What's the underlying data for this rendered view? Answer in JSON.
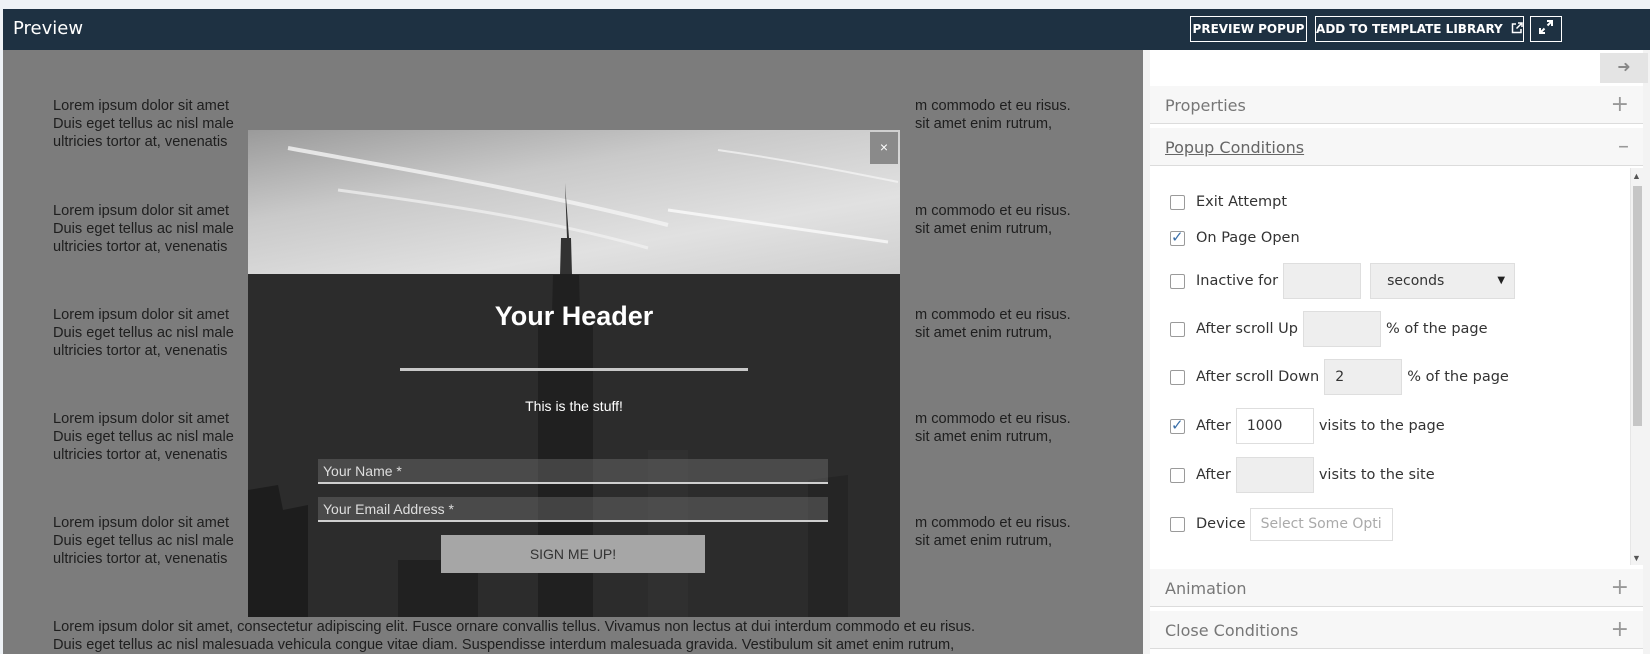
{
  "topbar": {
    "title": "Preview",
    "preview_popup_label": "PREVIEW POPUP",
    "add_template_label": "ADD TO TEMPLATE LIBRARY",
    "external_icon": "external-link-icon",
    "expand_icon": "expand-icon"
  },
  "preview": {
    "paragraphs": [
      {
        "l1": "Lorem ipsum dolor sit amet",
        "l2": "Duis eget tellus ac nisl male",
        "l3": "ultricies tortor at, venenatis",
        "r1": "m commodo et eu risus.",
        "r2": "sit amet enim rutrum,"
      },
      {
        "l1": "Lorem ipsum dolor sit amet",
        "l2": "Duis eget tellus ac nisl male",
        "l3": "ultricies tortor at, venenatis",
        "r1": "m commodo et eu risus.",
        "r2": "sit amet enim rutrum,"
      },
      {
        "l1": "Lorem ipsum dolor sit amet",
        "l2": "Duis eget tellus ac nisl male",
        "l3": "ultricies tortor at, venenatis",
        "r1": "m commodo et eu risus.",
        "r2": "sit amet enim rutrum,"
      },
      {
        "l1": "Lorem ipsum dolor sit amet",
        "l2": "Duis eget tellus ac nisl male",
        "l3": "ultricies tortor at, venenatis",
        "r1": "m commodo et eu risus.",
        "r2": "sit amet enim rutrum,"
      },
      {
        "l1": "Lorem ipsum dolor sit amet",
        "l2": "Duis eget tellus ac nisl male",
        "l3": "ultricies tortor at, venenatis",
        "r1": "m commodo et eu risus.",
        "r2": "sit amet enim rutrum,"
      }
    ],
    "last_line1": "Lorem ipsum dolor sit amet, consectetur adipiscing elit. Fusce ornare convallis tellus. Vivamus non lectus at dui interdum commodo et eu risus.",
    "last_line2": "Duis eget tellus ac nisl malesuada vehicula congue vitae diam. Suspendisse interdum malesuada gravida. Vestibulum sit amet enim rutrum,"
  },
  "popup": {
    "close_label": "×",
    "header": "Your Header",
    "subtext": "This is the stuff!",
    "name_placeholder": "Your Name *",
    "email_placeholder": "Your Email Address *",
    "submit_label": "SIGN ME UP!"
  },
  "sidebar": {
    "collapse_icon": "arrow-right-icon",
    "sections": {
      "properties": "Properties",
      "popup_conditions": "Popup Conditions",
      "animation": "Animation",
      "close_conditions": "Close Conditions"
    },
    "plus": "+",
    "minus": "–",
    "conditions": {
      "exit_attempt": {
        "label": "Exit Attempt",
        "checked": false
      },
      "on_page_open": {
        "label": "On Page Open",
        "checked": true
      },
      "inactive": {
        "label": "Inactive for",
        "value": "",
        "unit": "seconds",
        "checked": false
      },
      "scroll_up": {
        "label": "After scroll Up",
        "value": "",
        "suffix": "% of the page",
        "checked": false
      },
      "scroll_down": {
        "label": "After scroll Down",
        "value": "2",
        "suffix": "% of the page",
        "checked": false
      },
      "visits_page": {
        "label": "After",
        "value": "1000",
        "suffix": "visits to the page",
        "checked": true
      },
      "visits_site": {
        "label": "After",
        "value": "",
        "suffix": "visits to the site",
        "checked": false
      },
      "device": {
        "label": "Device",
        "placeholder": "Select Some Opti",
        "checked": false
      }
    }
  }
}
